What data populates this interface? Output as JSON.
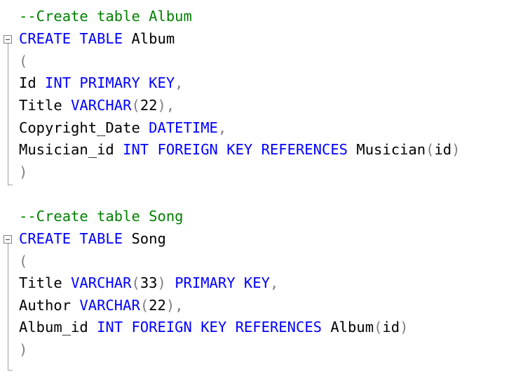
{
  "editor": {
    "comment_album": "--Create table Album",
    "comment_song": "--Create table Song",
    "keywords": {
      "create": "CREATE",
      "table": "TABLE",
      "int": "INT",
      "primary_key": "PRIMARY KEY",
      "foreign_key": "FOREIGN KEY",
      "references": "REFERENCES",
      "varchar": "VARCHAR",
      "datetime": "DATETIME"
    },
    "album": {
      "name": "Album",
      "col_id": "Id",
      "col_title": "Title",
      "title_len": "22",
      "col_copyright": "Copyright_Date",
      "col_musician": "Musician_id",
      "ref_table": "Musician",
      "ref_col": "id"
    },
    "song": {
      "name": "Song",
      "col_title": "Title",
      "title_len": "33",
      "col_author": "Author",
      "author_len": "22",
      "col_album": "Album_id",
      "ref_table": "Album",
      "ref_col": "id"
    },
    "punct": {
      "open": "(",
      "close": ")",
      "comma": ","
    }
  },
  "icons": {
    "fold": "collapse-minus-icon"
  },
  "colors": {
    "keyword": "#0000ff",
    "comment": "#008000",
    "punctuation": "#808080",
    "text": "#000000"
  }
}
